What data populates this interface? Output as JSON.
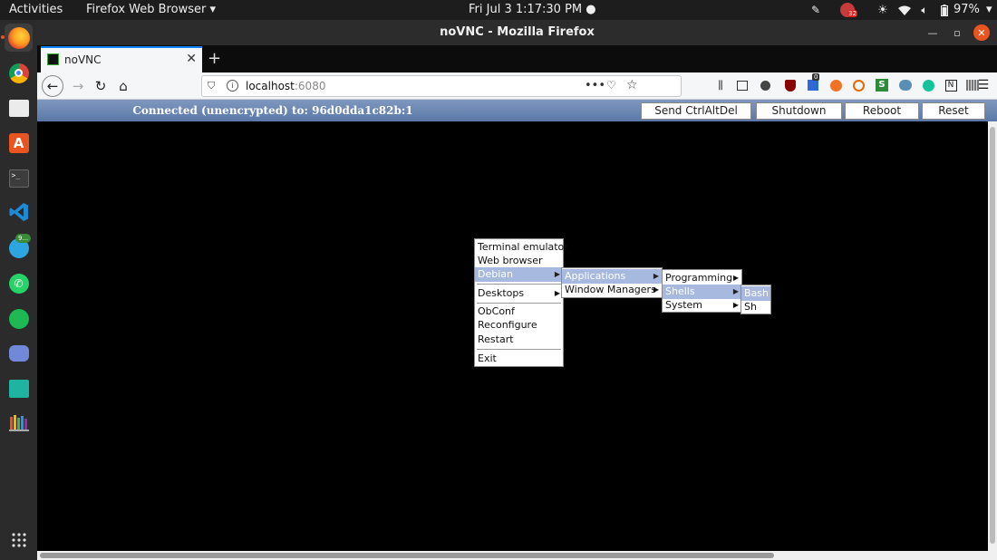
{
  "topbar": {
    "activities": "Activities",
    "app_menu": "Firefox Web Browser",
    "clock": "Fri Jul 3   1:17:30 PM",
    "notif_badge": "32",
    "battery": "97%"
  },
  "dock": {
    "items": [
      "firefox-icon",
      "chrome-icon",
      "files-icon",
      "software-center-icon",
      "terminal-icon",
      "vscode-icon",
      "telegram-icon",
      "whatsapp-icon",
      "spotify-icon",
      "discord-icon",
      "reader-icon",
      "library-icon",
      "app-grid-icon"
    ],
    "telegram_badge": "9..."
  },
  "window": {
    "title": "noVNC - Mozilla Firefox"
  },
  "tabs": [
    {
      "label": "noVNC"
    }
  ],
  "navbar": {
    "url_host": "localhost",
    "url_port": ":6080",
    "ext_badge": "0"
  },
  "novnc": {
    "status": "Connected (unencrypted) to: 96d0dda1c82b:1",
    "buttons": [
      "Send CtrlAltDel",
      "Shutdown",
      "Reboot",
      "Reset"
    ]
  },
  "menus": {
    "root": {
      "items": [
        "Terminal emulator",
        "Web browser",
        "Debian",
        "Desktops",
        "ObConf",
        "Reconfigure",
        "Restart",
        "Exit"
      ]
    },
    "debian": {
      "items": [
        "Applications",
        "Window Managers"
      ]
    },
    "applications": {
      "items": [
        "Programming",
        "Shells",
        "System"
      ]
    },
    "shells": {
      "items": [
        "Bash",
        "Sh"
      ]
    }
  },
  "colors": {
    "accent": "#0a84ff",
    "vnc_bar": "#6f89b5",
    "menu_highlight": "#a7b9df"
  }
}
